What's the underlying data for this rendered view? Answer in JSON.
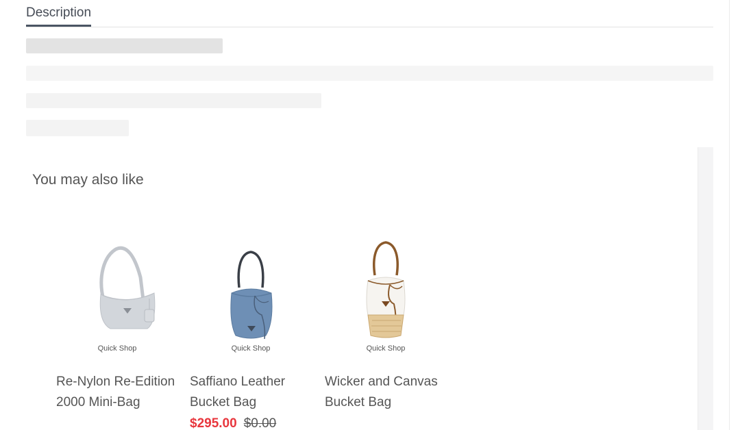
{
  "tabs": [
    {
      "label": "Description",
      "active": true
    }
  ],
  "recommendations": {
    "title": "You may also like",
    "products": [
      {
        "name": "Re-Nylon Re-Edition 2000 Mini-Bag",
        "quick_shop": "Quick Shop",
        "sale_price": "",
        "original_price": "",
        "image_icon": "white-nylon-hobo-bag-icon",
        "colors": {
          "body": "#d2d6db",
          "strap": "#c2c6cc"
        }
      },
      {
        "name": "Saffiano Leather Bucket Bag",
        "quick_shop": "Quick Shop",
        "sale_price": "$295.00",
        "original_price": "$0.00",
        "image_icon": "blue-bucket-bag-icon",
        "colors": {
          "body": "#6e8fb5",
          "strap": "#3a3f47"
        }
      },
      {
        "name": "Wicker and Canvas Bucket Bag",
        "quick_shop": "Quick Shop",
        "sale_price": "",
        "original_price": "",
        "image_icon": "wicker-canvas-bucket-bag-icon",
        "colors": {
          "body": "#f6f4f0",
          "strap": "#8b5a2b",
          "wicker": "#e3c898"
        }
      }
    ]
  },
  "colors": {
    "sale_price": "#e8363d",
    "tab_underline": "#4a5563"
  }
}
